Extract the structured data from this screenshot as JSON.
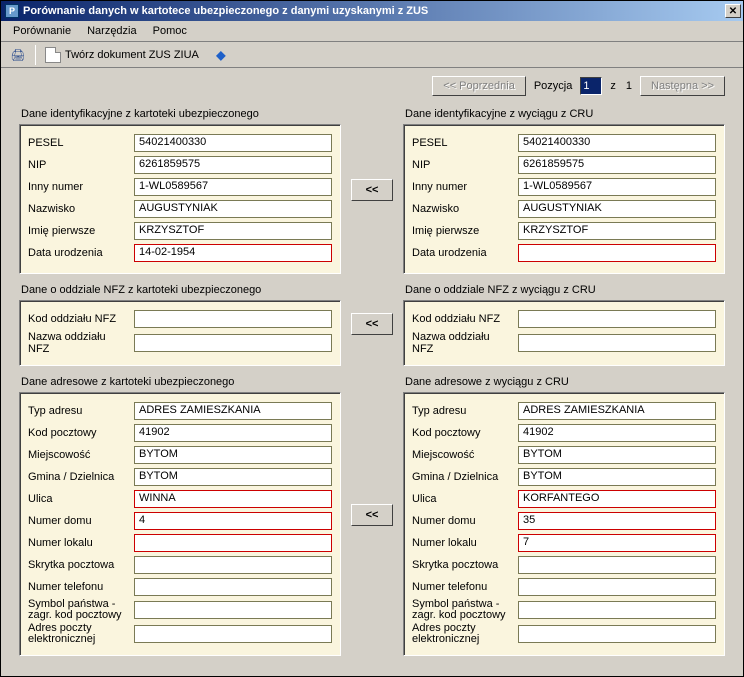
{
  "window": {
    "title": "Porównanie danych w kartotece ubezpieczonego z danymi uzyskanymi z ZUS"
  },
  "menu": {
    "porownanie": "Porównanie",
    "narzedzia": "Narzędzia",
    "pomoc": "Pomoc"
  },
  "toolbar": {
    "tworz": "Twórz dokument ZUS ZIUA"
  },
  "pager": {
    "prev": "<< Poprzednia",
    "pozycja": "Pozycja",
    "current": "1",
    "z": "z",
    "total": "1",
    "next": "Następna >>"
  },
  "sections": {
    "ident_left_title": "Dane identyfikacyjne z kartoteki ubezpieczonego",
    "ident_right_title": "Dane identyfikacyjne z wyciągu z CRU",
    "nfz_left_title": "Dane o oddziale NFZ z kartoteki ubezpieczonego",
    "nfz_right_title": "Dane o oddziale NFZ z wyciągu z CRU",
    "addr_left_title": "Dane adresowe z kartoteki ubezpieczonego",
    "addr_right_title": "Dane adresowe z wyciągu z CRU"
  },
  "labels": {
    "pesel": "PESEL",
    "nip": "NIP",
    "inny": "Inny numer",
    "nazwisko": "Nazwisko",
    "imie": "Imię pierwsze",
    "data_ur": "Data urodzenia",
    "kod_nfz": "Kod oddziału NFZ",
    "nazwa_nfz": "Nazwa oddziału NFZ",
    "typ_adresu": "Typ adresu",
    "kod_pocztowy": "Kod pocztowy",
    "miejscowosc": "Miejscowość",
    "gmina": "Gmina / Dzielnica",
    "ulica": "Ulica",
    "nr_domu": "Numer domu",
    "nr_lokalu": "Numer lokalu",
    "skrytka": "Skrytka pocztowa",
    "telefon": "Numer telefonu",
    "symbol": "Symbol państwa - zagr. kod pocztowy",
    "email": "Adres poczty elektronicznej"
  },
  "left": {
    "pesel": "54021400330",
    "nip": "6261859575",
    "inny": "1-WL0589567",
    "nazwisko": "AUGUSTYNIAK",
    "imie": "KRZYSZTOF",
    "data_ur": "14-02-1954",
    "kod_nfz": "",
    "nazwa_nfz": "",
    "typ_adresu": "ADRES ZAMIESZKANIA",
    "kod_pocztowy": "41902",
    "miejscowosc": "BYTOM",
    "gmina": "BYTOM",
    "ulica": "WINNA",
    "nr_domu": "4",
    "nr_lokalu": "",
    "skrytka": "",
    "telefon": "",
    "symbol": "",
    "email": ""
  },
  "right": {
    "pesel": "54021400330",
    "nip": "6261859575",
    "inny": "1-WL0589567",
    "nazwisko": "AUGUSTYNIAK",
    "imie": "KRZYSZTOF",
    "data_ur": "",
    "kod_nfz": "",
    "nazwa_nfz": "",
    "typ_adresu": "ADRES ZAMIESZKANIA",
    "kod_pocztowy": "41902",
    "miejscowosc": "BYTOM",
    "gmina": "BYTOM",
    "ulica": "KORFANTEGO",
    "nr_domu": "35",
    "nr_lokalu": "7",
    "skrytka": "",
    "telefon": "",
    "symbol": "",
    "email": ""
  },
  "arrow": "<<"
}
